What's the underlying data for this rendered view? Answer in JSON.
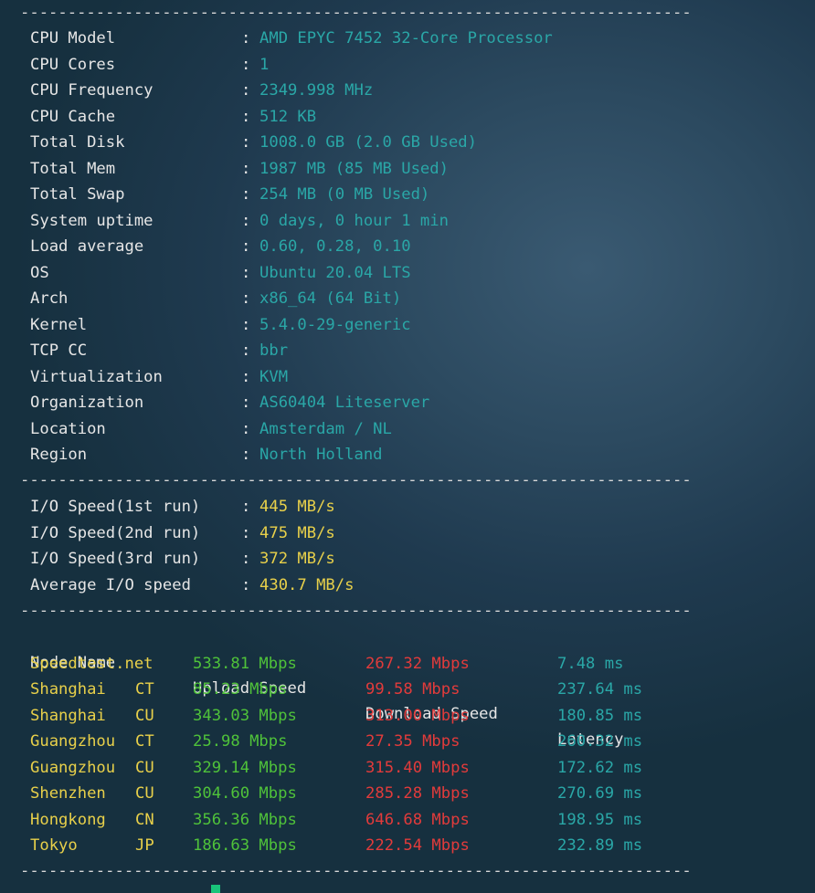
{
  "separator": "--------------------------------------------------------------------------",
  "system_info": [
    {
      "key": "CPU Model",
      "value": "AMD EPYC 7452 32-Core Processor"
    },
    {
      "key": "CPU Cores",
      "value": "1"
    },
    {
      "key": "CPU Frequency",
      "value": "2349.998 MHz"
    },
    {
      "key": "CPU Cache",
      "value": "512 KB"
    },
    {
      "key": "Total Disk",
      "value": "1008.0 GB (2.0 GB Used)"
    },
    {
      "key": "Total Mem",
      "value": "1987 MB (85 MB Used)"
    },
    {
      "key": "Total Swap",
      "value": "254 MB (0 MB Used)"
    },
    {
      "key": "System uptime",
      "value": "0 days, 0 hour 1 min"
    },
    {
      "key": "Load average",
      "value": "0.60, 0.28, 0.10"
    },
    {
      "key": "OS",
      "value": "Ubuntu 20.04 LTS"
    },
    {
      "key": "Arch",
      "value": "x86_64 (64 Bit)"
    },
    {
      "key": "Kernel",
      "value": "5.4.0-29-generic"
    },
    {
      "key": "TCP CC",
      "value": "bbr"
    },
    {
      "key": "Virtualization",
      "value": "KVM"
    },
    {
      "key": "Organization",
      "value": "AS60404 Liteserver"
    },
    {
      "key": "Location",
      "value": "Amsterdam / NL"
    },
    {
      "key": "Region",
      "value": "North Holland"
    }
  ],
  "io_speed": [
    {
      "key": "I/O Speed(1st run)",
      "value": "445 MB/s"
    },
    {
      "key": "I/O Speed(2nd run)",
      "value": "475 MB/s"
    },
    {
      "key": "I/O Speed(3rd run)",
      "value": "372 MB/s"
    },
    {
      "key": "Average I/O speed",
      "value": "430.7 MB/s"
    }
  ],
  "speedtest": {
    "headers": {
      "node": "Node Name",
      "upload": "Upload Speed",
      "download": "Download Speed",
      "latency": "Latency"
    },
    "rows": [
      {
        "node": "Speedtest.net",
        "isp": "",
        "upload": "533.81 Mbps",
        "download": "267.32 Mbps",
        "latency": "7.48 ms"
      },
      {
        "node": "Shanghai",
        "isp": "CT",
        "upload": "85.23 Mbps",
        "download": "99.58 Mbps",
        "latency": "237.64 ms"
      },
      {
        "node": "Shanghai",
        "isp": "CU",
        "upload": "343.03 Mbps",
        "download": "313.00 Mbps",
        "latency": "180.85 ms"
      },
      {
        "node": "Guangzhou",
        "isp": "CT",
        "upload": "25.98 Mbps",
        "download": "27.35 Mbps",
        "latency": "260.32 ms"
      },
      {
        "node": "Guangzhou",
        "isp": "CU",
        "upload": "329.14 Mbps",
        "download": "315.40 Mbps",
        "latency": "172.62 ms"
      },
      {
        "node": "Shenzhen",
        "isp": "CU",
        "upload": "304.60 Mbps",
        "download": "285.28 Mbps",
        "latency": "270.69 ms"
      },
      {
        "node": "Hongkong",
        "isp": "CN",
        "upload": "356.36 Mbps",
        "download": "646.68 Mbps",
        "latency": "198.95 ms"
      },
      {
        "node": "Tokyo",
        "isp": "JP",
        "upload": "186.63 Mbps",
        "download": "222.54 Mbps",
        "latency": "232.89 ms"
      }
    ]
  },
  "colors": {
    "key_text": "#e6e6e6",
    "info_value": "#2aa7a7",
    "io_value": "#e8d04a",
    "node_name": "#e8d04a",
    "upload": "#4fc23a",
    "download": "#e23b3b",
    "latency": "#2aa7a7",
    "cursor": "#19c47a"
  }
}
